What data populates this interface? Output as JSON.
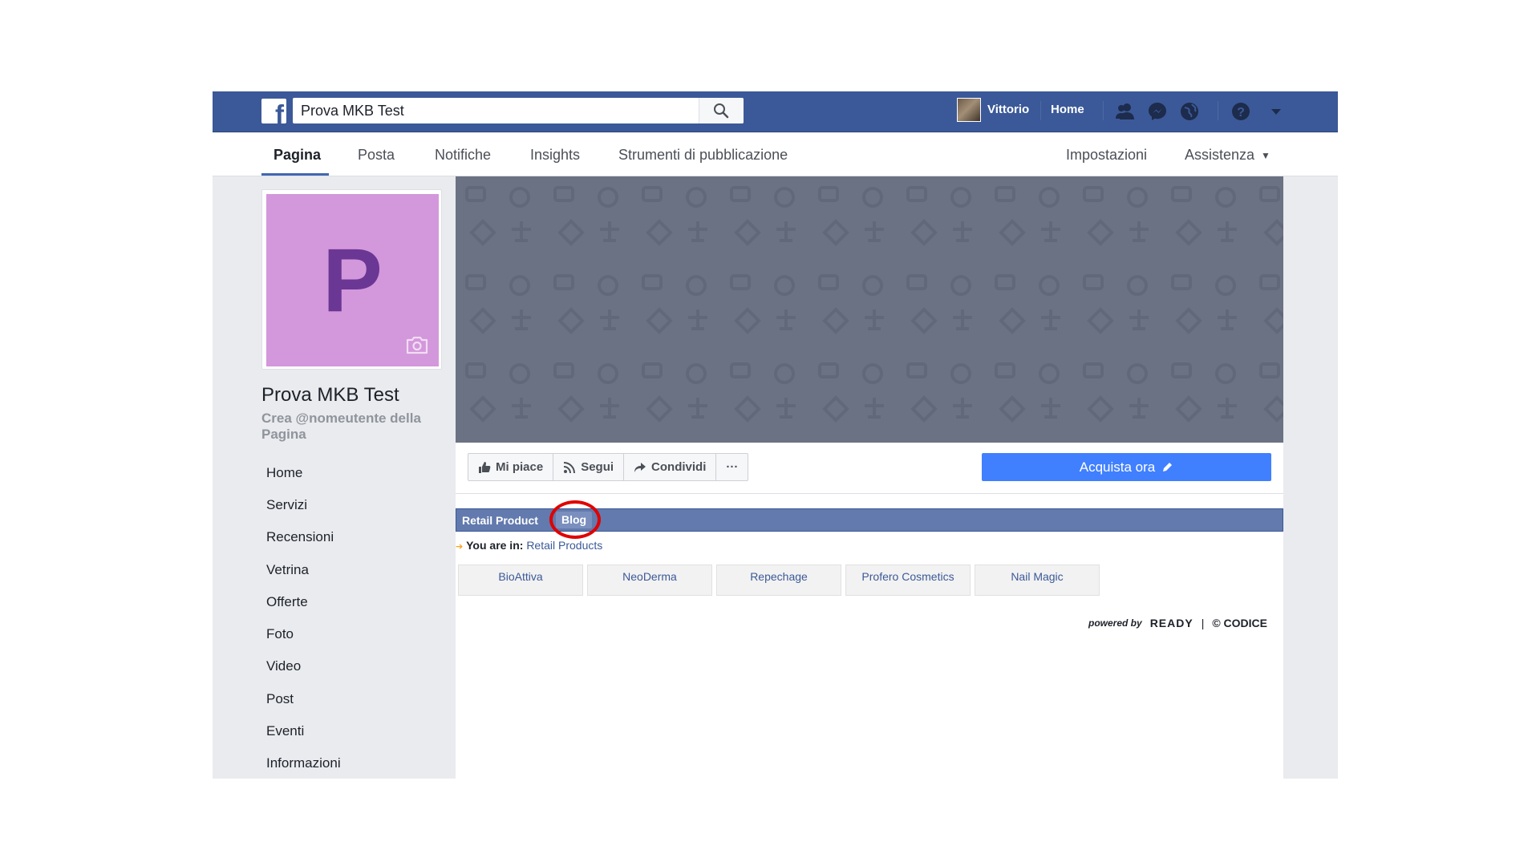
{
  "topbar": {
    "logo_letter": "f",
    "search_value": "Prova MKB Test",
    "user_name": "Vittorio",
    "home_label": "Home",
    "icons": [
      "friends-icon",
      "messenger-icon",
      "globe-icon",
      "help-icon",
      "dropdown-icon"
    ]
  },
  "subnav": {
    "tabs": [
      {
        "label": "Pagina",
        "active": true
      },
      {
        "label": "Posta"
      },
      {
        "label": "Notifiche"
      },
      {
        "label": "Insights"
      },
      {
        "label": "Strumenti di pubblicazione"
      }
    ],
    "right": [
      {
        "label": "Impostazioni"
      },
      {
        "label": "Assistenza"
      }
    ]
  },
  "profile": {
    "letter": "P",
    "name": "Prova MKB Test",
    "username_prompt": "Crea @nomeutente della Pagina",
    "bg_color": "#d397db"
  },
  "sidebar": {
    "items": [
      {
        "label": "Home"
      },
      {
        "label": "Servizi"
      },
      {
        "label": "Recensioni"
      },
      {
        "label": "Vetrina"
      },
      {
        "label": "Offerte"
      },
      {
        "label": "Foto"
      },
      {
        "label": "Video"
      },
      {
        "label": "Post"
      },
      {
        "label": "Eventi"
      },
      {
        "label": "Informazioni"
      }
    ]
  },
  "actions": {
    "like": "Mi piace",
    "follow": "Segui",
    "share": "Condividi",
    "more": "···",
    "buy": "Acquista ora"
  },
  "app": {
    "nav": {
      "retail": "Retail Product",
      "blog": "Blog"
    },
    "breadcrumb": {
      "label": "You are in:",
      "link": "Retail Products"
    },
    "brands": [
      "BioAttiva",
      "NeoDerma",
      "Repechage",
      "Profero Cosmetics",
      "Nail Magic"
    ],
    "powered": {
      "by": "powered by",
      "ready": "READY",
      "sep": "|",
      "codice": "© CODICE"
    }
  },
  "colors": {
    "fb_blue": "#3b5998",
    "accent": "#4080ff",
    "highlight": "#e00000"
  }
}
